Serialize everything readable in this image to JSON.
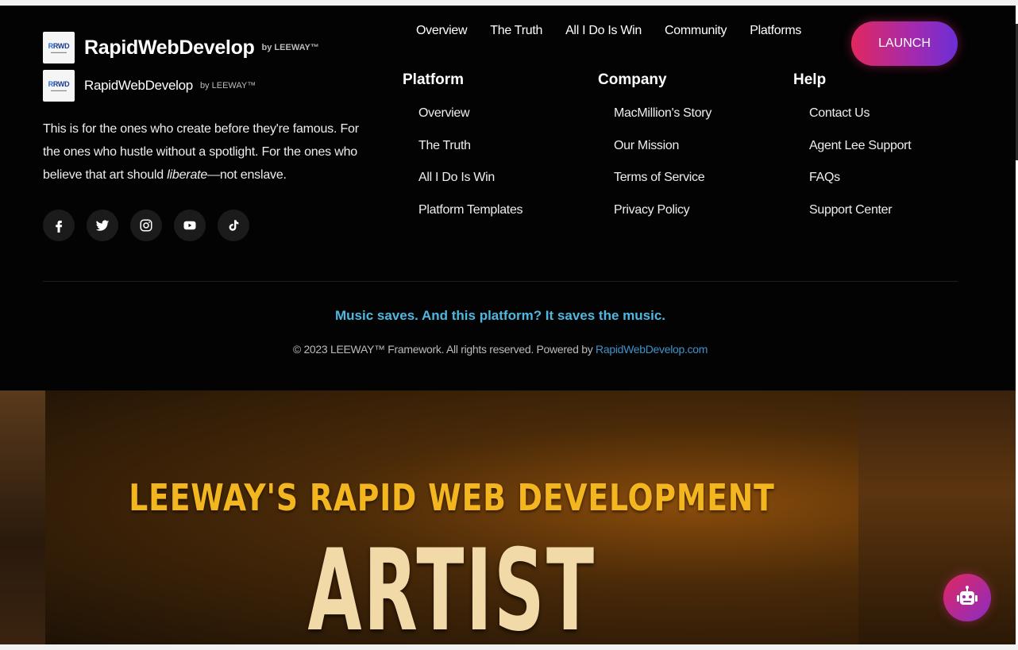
{
  "brand": {
    "logo_text": "RWD",
    "logo_r": "R",
    "name": "RapidWebDevelop",
    "by": "by LEEWAY™"
  },
  "tagline": {
    "part1": "This is for the ones who create before they're famous. For the ones who hustle without a spotlight. For the ones who believe that art should ",
    "emphasis": "liberate",
    "part2": "—not enslave."
  },
  "socials": [
    {
      "name": "facebook-icon"
    },
    {
      "name": "twitter-icon"
    },
    {
      "name": "instagram-icon"
    },
    {
      "name": "youtube-icon"
    },
    {
      "name": "tiktok-icon"
    }
  ],
  "topnav": [
    "Overview",
    "The Truth",
    "All I Do Is Win",
    "Community",
    "Platforms"
  ],
  "launch_label": "LAUNCH",
  "columns": {
    "platform": {
      "title": "Platform",
      "items": [
        "Overview",
        "The Truth",
        "All I Do Is Win",
        "Platform Templates"
      ]
    },
    "company": {
      "title": "Company",
      "items": [
        "MacMillion's Story",
        "Our Mission",
        "Terms of Service",
        "Privacy Policy"
      ]
    },
    "help": {
      "title": "Help",
      "items": [
        "Contact Us",
        "Agent Lee Support",
        "FAQs",
        "Support Center"
      ]
    }
  },
  "motto": "Music saves. And this platform? It saves the music.",
  "copyright": {
    "text": "© 2023 LEEWAY™ Framework. All rights reserved. Powered by ",
    "link": "RapidWebDevelop.com"
  },
  "hero": {
    "subtitle": "LEEWAY'S RAPID WEB DEVELOPMENT",
    "title": "ARTIST"
  },
  "colors": {
    "accent_pink": "#e0285f",
    "accent_purple": "#6a2fd6",
    "motto_blue": "#4fb8e0",
    "hero_gold": "#f4b61e"
  }
}
